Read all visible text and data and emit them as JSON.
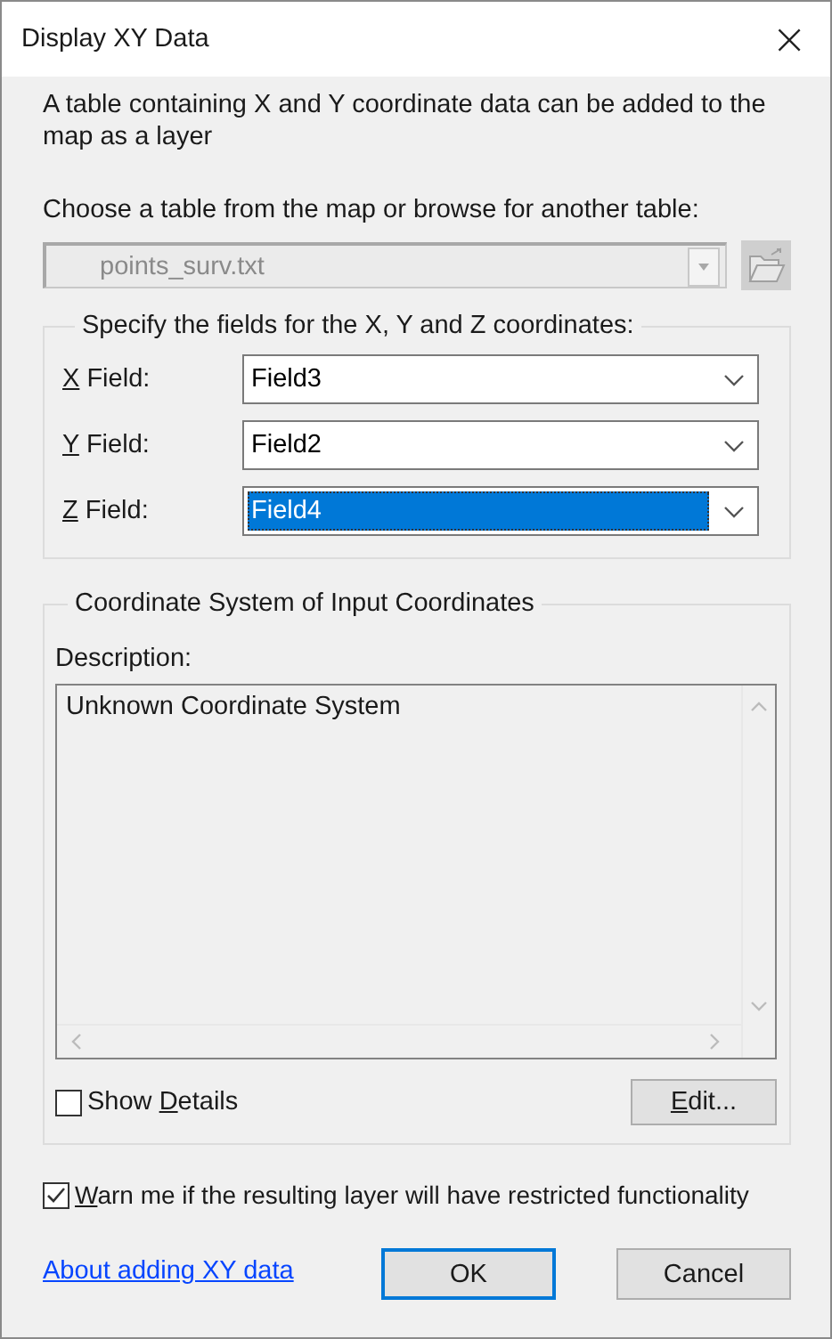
{
  "window": {
    "title": "Display XY Data",
    "close": "×"
  },
  "intro": "A table containing X and Y coordinate data can be added to the map as a layer",
  "table_prompt": "Choose a table from the map or browse for another table:",
  "table_combo": {
    "value": "points_surv.txt",
    "disabled": true
  },
  "fields_group": {
    "title": "Specify the fields for the X, Y and Z coordinates:",
    "fields": [
      {
        "label_key": "X",
        "label_rest": " Field:",
        "value": "Field3",
        "focused": false
      },
      {
        "label_key": "Y",
        "label_rest": " Field:",
        "value": "Field2",
        "focused": false
      },
      {
        "label_key": "Z",
        "label_rest": " Field:",
        "value": "Field4",
        "focused": true
      }
    ]
  },
  "coord_group": {
    "title": "Coordinate System of Input Coordinates",
    "description_label": "Description:",
    "description": "Unknown Coordinate System",
    "show_details": {
      "label_start": "Show ",
      "label_key": "D",
      "label_rest": "etails",
      "checked": false
    },
    "edit_button": {
      "label_key": "E",
      "label_rest": "dit..."
    }
  },
  "warn_checkbox": {
    "label_key": "W",
    "label_rest": "arn me if the resulting layer will have restricted functionality",
    "checked": true
  },
  "help_link": "About adding XY data",
  "buttons": [
    {
      "label": "OK",
      "default": true
    },
    {
      "label": "Cancel",
      "default": false
    }
  ]
}
